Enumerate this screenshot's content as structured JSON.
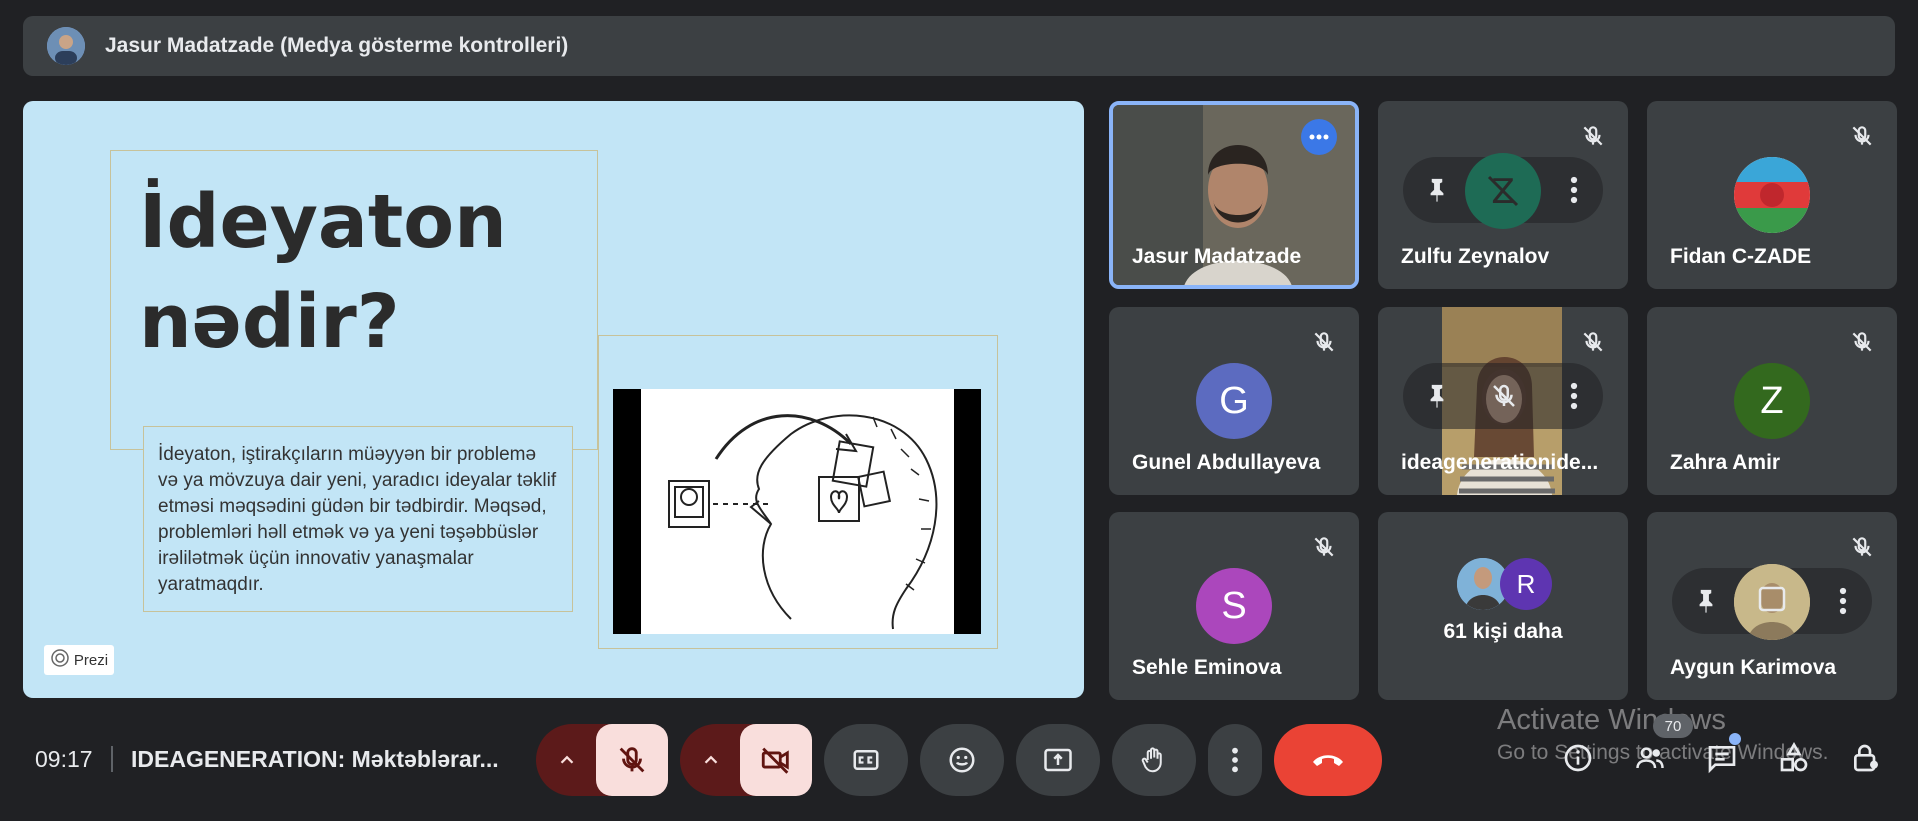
{
  "presenter_bar": {
    "title": "Jasur Madatzade (Medya gösterme kontrolleri)"
  },
  "slide": {
    "title": "İdeyaton\nnədir?",
    "body": "İdeyaton, iştirakçıların müəyyən bir problemə və ya mövzuya dair yeni, yaradıcı ideyalar təklif etməsi məqsədini güdən bir tədbirdir. Məqsəd, problemləri həll etmək və ya yeni təşəbbüslər irəlilətmək üçün innovativ yanaşmalar yaratmaqdır.",
    "badge": "Prezi"
  },
  "participants": [
    {
      "name": "Jasur Madatzade",
      "avatar_letter": "",
      "avatar_color": ""
    },
    {
      "name": "Zulfu Zeynalov",
      "avatar_letter": "",
      "avatar_color": "#1e6b55"
    },
    {
      "name": "Fidan C-ZADE",
      "avatar_letter": "",
      "avatar_color": "#b03b3b"
    },
    {
      "name": "Gunel Abdullayeva",
      "avatar_letter": "G",
      "avatar_color": "#5c6bc0"
    },
    {
      "name": "ideagenerationide...",
      "avatar_letter": "",
      "avatar_color": ""
    },
    {
      "name": "Zahra Amir",
      "avatar_letter": "Z",
      "avatar_color": "#33691e"
    },
    {
      "name": "Sehle Eminova",
      "avatar_letter": "S",
      "avatar_color": "#ab47bc"
    },
    {
      "name": "61 kişi daha",
      "avatar_letter": "R",
      "avatar_color": "#5e35b1"
    },
    {
      "name": "Aygun Karimova",
      "avatar_letter": "",
      "avatar_color": "#c8b88a"
    }
  ],
  "bottom_bar": {
    "time": "09:17",
    "meeting_name": "IDEAGENERATION: Məktəblərar...",
    "people_count": "70"
  },
  "watermark": {
    "title": "Activate Windows",
    "subtitle": "Go to Settings to activate Windows."
  },
  "colors": {
    "accent": "#8ab4f8",
    "end_call": "#ea4335",
    "muted_bg": "#f9dedc"
  }
}
